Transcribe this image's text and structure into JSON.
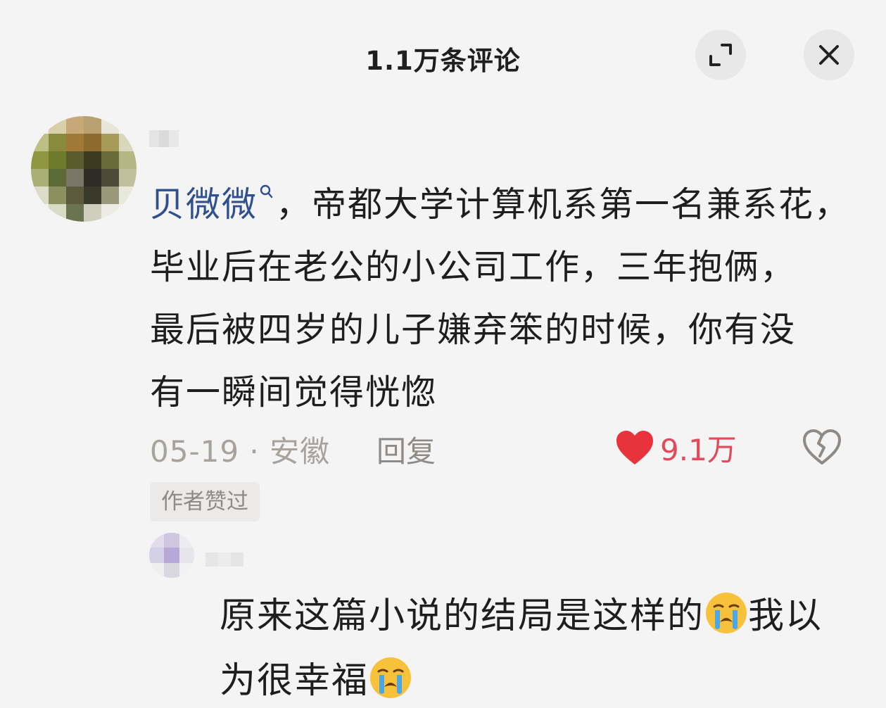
{
  "header": {
    "title": "1.1万条评论"
  },
  "comment": {
    "mention": "贝微微",
    "text_lines": [
      "，帝都大学计算机系第一名兼系花，",
      "毕业后在老公的小公司工作，三年抱俩，",
      "最后被四岁的儿子嫌弃笨的时候，你有没",
      "有一瞬间觉得恍惚"
    ],
    "date": "05-19",
    "separator": "·",
    "location": "安徽",
    "reply_label": "回复",
    "like_count": "9.1万",
    "author_liked_badge": "作者赞过"
  },
  "reply": {
    "part1": "原来这篇小说的结局是这样的",
    "part2": "我以",
    "part3": "为很幸福"
  },
  "colors": {
    "background": "#f4f4f4",
    "mention_blue": "#2f4f8f",
    "like_red": "#e24a5a",
    "muted_text": "#a8a29c"
  },
  "icons": {
    "expand": "expand-icon",
    "close": "close-icon",
    "heart": "heart-icon",
    "broken_heart": "broken-heart-icon",
    "cry": "loudly-crying-face-emoji",
    "search": "search-icon"
  }
}
